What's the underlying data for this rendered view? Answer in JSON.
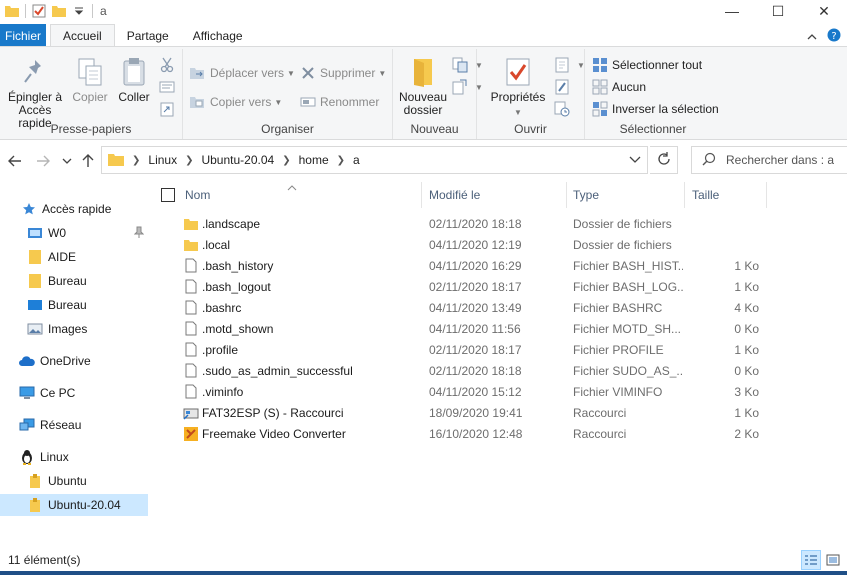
{
  "window": {
    "title": "a",
    "controls": {
      "minimize": "—",
      "maximize": "☐",
      "close": "✕"
    }
  },
  "ribbon_tabs": [
    {
      "label": "Fichier"
    },
    {
      "label": "Accueil"
    },
    {
      "label": "Partage"
    },
    {
      "label": "Affichage"
    }
  ],
  "ribbon": {
    "presse_papiers": {
      "label": "Presse-papiers",
      "pin_line1": "Épingler à",
      "pin_line2": "Accès rapide",
      "copy": "Copier",
      "paste": "Coller"
    },
    "organiser": {
      "label": "Organiser",
      "move_to": "Déplacer vers",
      "copy_to": "Copier vers",
      "delete": "Supprimer",
      "rename": "Renommer"
    },
    "nouveau": {
      "label": "Nouveau",
      "new_folder_line1": "Nouveau",
      "new_folder_line2": "dossier"
    },
    "ouvrir": {
      "label": "Ouvrir",
      "properties": "Propriétés"
    },
    "selectionner": {
      "label": "Sélectionner",
      "select_all": "Sélectionner tout",
      "select_none": "Aucun",
      "invert": "Inverser la sélection"
    }
  },
  "address": {
    "breadcrumbs": [
      "Linux",
      "Ubuntu-20.04",
      "home",
      "a"
    ]
  },
  "search": {
    "placeholder": "Rechercher dans : a"
  },
  "nav_pane": [
    {
      "label": "Accès rapide",
      "icon": "star-icon",
      "pinned": false
    },
    {
      "label": "W0",
      "icon": "drive-icon",
      "pinned": true
    },
    {
      "label": "AIDE",
      "icon": "folder-icon",
      "pinned": false
    },
    {
      "label": "Bureau",
      "icon": "folder-icon",
      "pinned": false
    },
    {
      "label": "Bureau",
      "icon": "desktop-icon",
      "pinned": false
    },
    {
      "label": "Images",
      "icon": "images-icon",
      "pinned": false
    },
    {
      "label": "OneDrive",
      "icon": "cloud-icon",
      "pinned": false
    },
    {
      "label": "Ce PC",
      "icon": "pc-icon",
      "pinned": false
    },
    {
      "label": "Réseau",
      "icon": "network-icon",
      "pinned": false
    },
    {
      "label": "Linux",
      "icon": "linux-icon",
      "pinned": false
    },
    {
      "label": "Ubuntu",
      "icon": "linux-folder-icon",
      "pinned": false
    },
    {
      "label": "Ubuntu-20.04",
      "icon": "linux-folder-icon",
      "pinned": false,
      "selected": true
    }
  ],
  "columns": {
    "name": "Nom",
    "modified": "Modifié le",
    "type": "Type",
    "size": "Taille"
  },
  "files": [
    {
      "name": ".landscape",
      "modified": "02/11/2020 18:18",
      "type": "Dossier de fichiers",
      "size": "",
      "icon": "folder-icon"
    },
    {
      "name": ".local",
      "modified": "04/11/2020 12:19",
      "type": "Dossier de fichiers",
      "size": "",
      "icon": "folder-icon"
    },
    {
      "name": ".bash_history",
      "modified": "04/11/2020 16:29",
      "type": "Fichier BASH_HIST...",
      "size": "1 Ko",
      "icon": "file-icon"
    },
    {
      "name": ".bash_logout",
      "modified": "02/11/2020 18:17",
      "type": "Fichier BASH_LOG...",
      "size": "1 Ko",
      "icon": "file-icon"
    },
    {
      "name": ".bashrc",
      "modified": "04/11/2020 13:49",
      "type": "Fichier BASHRC",
      "size": "4 Ko",
      "icon": "file-icon"
    },
    {
      "name": ".motd_shown",
      "modified": "04/11/2020 11:56",
      "type": "Fichier MOTD_SH...",
      "size": "0 Ko",
      "icon": "file-icon"
    },
    {
      "name": ".profile",
      "modified": "02/11/2020 18:17",
      "type": "Fichier PROFILE",
      "size": "1 Ko",
      "icon": "file-icon"
    },
    {
      "name": ".sudo_as_admin_successful",
      "modified": "02/11/2020 18:18",
      "type": "Fichier SUDO_AS_...",
      "size": "0 Ko",
      "icon": "file-icon"
    },
    {
      "name": ".viminfo",
      "modified": "04/11/2020 15:12",
      "type": "Fichier VIMINFO",
      "size": "3 Ko",
      "icon": "file-icon"
    },
    {
      "name": "FAT32ESP (S) - Raccourci",
      "modified": "18/09/2020 19:41",
      "type": "Raccourci",
      "size": "1 Ko",
      "icon": "shortcut-drive-icon"
    },
    {
      "name": "Freemake Video Converter",
      "modified": "16/10/2020 12:48",
      "type": "Raccourci",
      "size": "2 Ko",
      "icon": "freemake-icon"
    }
  ],
  "status": {
    "count": "11 élément(s)"
  },
  "colors": {
    "accent": "#1979ca",
    "folder": "#f6c94e",
    "selection": "#cce8ff"
  }
}
